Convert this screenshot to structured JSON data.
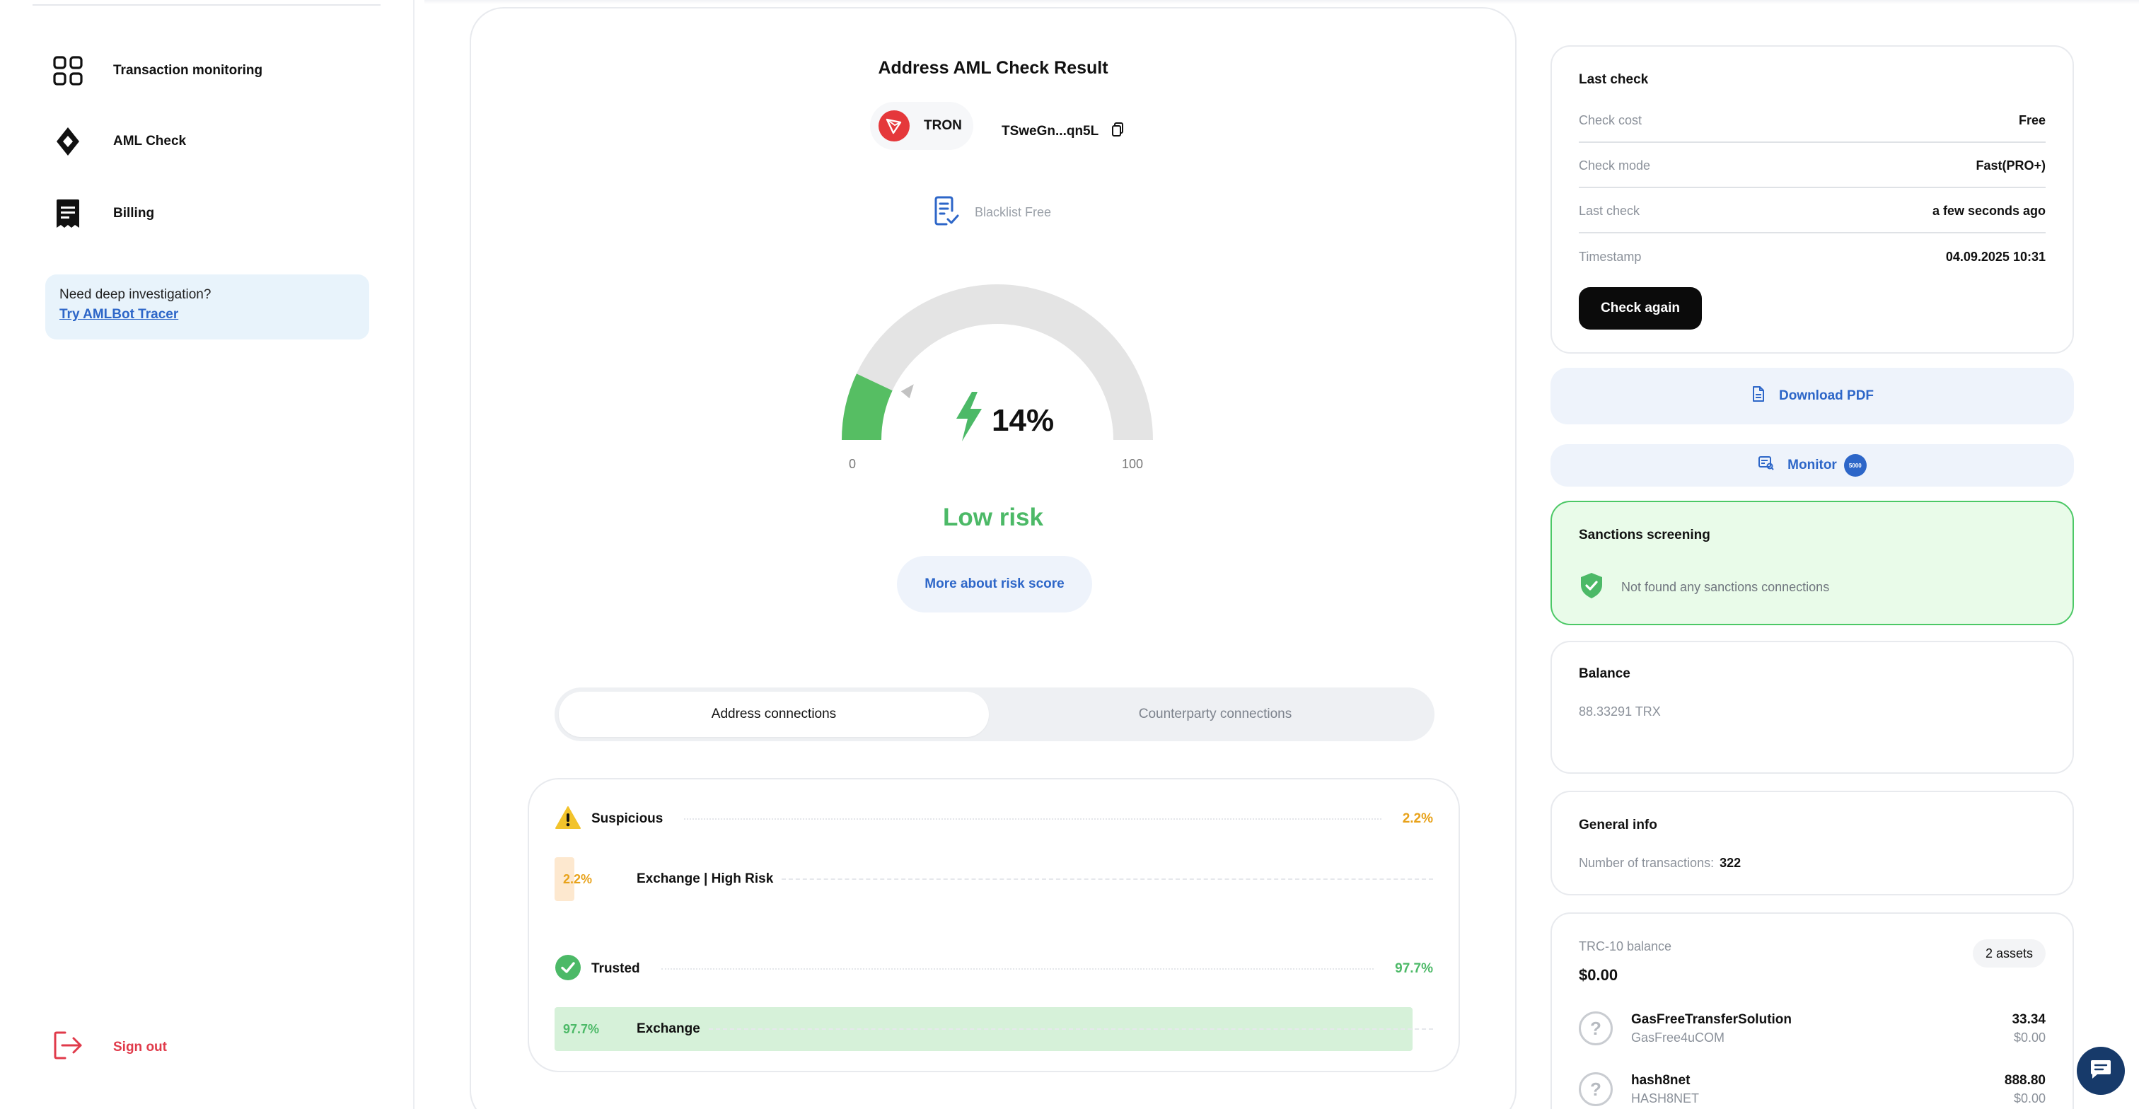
{
  "sidebar": {
    "items": [
      {
        "label": "Transaction monitoring",
        "icon": "grid-icon"
      },
      {
        "label": "AML Check",
        "icon": "diamond-icon"
      },
      {
        "label": "Billing",
        "icon": "receipt-icon"
      }
    ],
    "promo": {
      "question": "Need deep investigation?",
      "link": "Try AMLBot Tracer"
    },
    "sign_out": "Sign out"
  },
  "result": {
    "title": "Address AML Check Result",
    "network": "TRON",
    "address": "TSweGn...qn5L",
    "blacklist": "Blacklist Free",
    "score_text": "14%",
    "score": 14,
    "gauge_min": "0",
    "gauge_max": "100",
    "risk_label": "Low risk",
    "more_button": "More about risk score",
    "tabs": [
      "Address connections",
      "Counterparty connections"
    ],
    "categories": [
      {
        "name": "Suspicious",
        "pct": "2.2%",
        "color": "#e8a21a",
        "items": [
          {
            "pct": "2.2%",
            "name": "Exchange | High Risk",
            "fraction": 0.022
          }
        ]
      },
      {
        "name": "Trusted",
        "pct": "97.7%",
        "color": "#4cb967",
        "items": [
          {
            "pct": "97.7%",
            "name": "Exchange",
            "fraction": 0.977
          }
        ]
      }
    ]
  },
  "last_check": {
    "title": "Last check",
    "rows": [
      {
        "k": "Check cost",
        "v": "Free"
      },
      {
        "k": "Check mode",
        "v": "Fast(PRO+)"
      },
      {
        "k": "Last check",
        "v": "a few seconds ago"
      },
      {
        "k": "Timestamp",
        "v": "04.09.2025 10:31"
      }
    ],
    "button": "Check again"
  },
  "download_pdf": "Download PDF",
  "monitor": {
    "label": "Monitor",
    "badge": "5000"
  },
  "sanctions": {
    "title": "Sanctions screening",
    "text": "Not found any sanctions connections"
  },
  "balance": {
    "title": "Balance",
    "value": "88.33291 TRX"
  },
  "general": {
    "title": "General info",
    "label": "Number of transactions:",
    "value": "322"
  },
  "trc10": {
    "title": "TRC-10 balance",
    "assets_badge": "2 assets",
    "total": "$0.00",
    "assets": [
      {
        "name": "GasFreeTransferSolution",
        "symbol": "GasFree4uCOM",
        "amount": "33.34",
        "usd": "$0.00"
      },
      {
        "name": "hash8net",
        "symbol": "HASH8NET",
        "amount": "888.80",
        "usd": "$0.00"
      }
    ]
  },
  "colors": {
    "accent": "#2d66c8",
    "low_risk": "#4cb967",
    "warning": "#e8a21a",
    "tron": "#e5383b"
  }
}
